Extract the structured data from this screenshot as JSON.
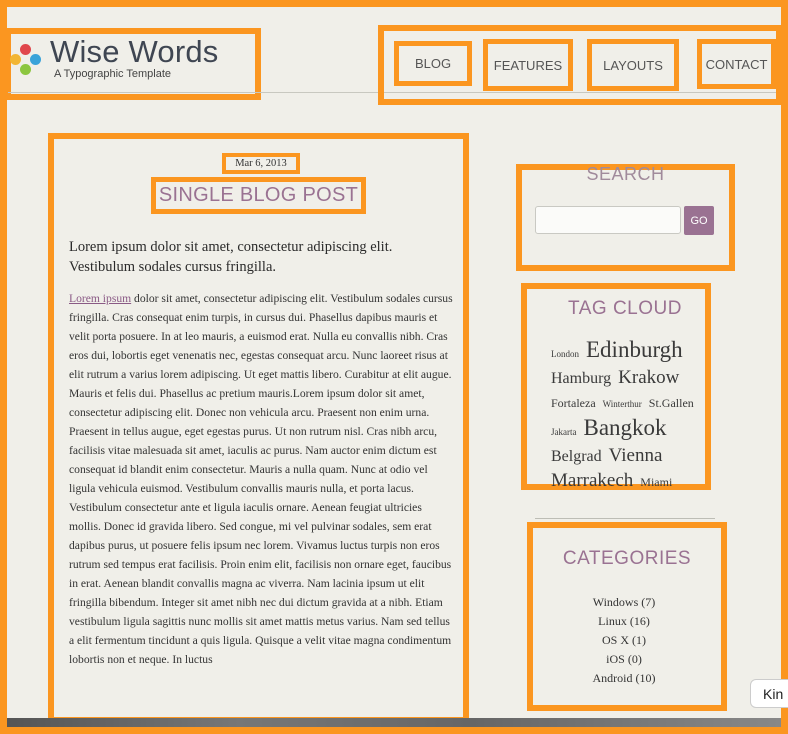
{
  "header": {
    "site_title": "Wise Words",
    "tagline": "A Typographic Template",
    "logo_colors": [
      "#e0474c",
      "#3aa3d9",
      "#f2b634",
      "#8cc63f"
    ]
  },
  "nav": {
    "items": [
      "BLOG",
      "FEATURES",
      "LAYOUTS",
      "CONTACT"
    ]
  },
  "post": {
    "date": "Mar 6, 2013",
    "title": "SINGLE BLOG POST",
    "lead": "Lorem ipsum dolor sit amet, consectetur adipiscing elit. Vestibulum sodales cursus fringilla.",
    "link_text": "Lorem ipsum",
    "body": " dolor sit amet, consectetur adipiscing elit. Vestibulum sodales cursus fringilla. Cras consequat enim turpis, in cursus dui. Phasellus dapibus mauris et velit porta posuere. In at leo mauris, a euismod erat. Nulla eu convallis nibh. Cras eros dui, lobortis eget venenatis nec, egestas consequat arcu. Nunc laoreet risus at elit rutrum a varius lorem adipiscing. Ut eget mattis libero. Curabitur at elit augue. Mauris et felis dui. Phasellus ac pretium mauris.Lorem ipsum dolor sit amet, consectetur adipiscing elit. Donec non vehicula arcu. Praesent non enim urna. Praesent in tellus augue, eget egestas purus. Ut non rutrum nisl. Cras nibh arcu, facilisis vitae malesuada sit amet, iaculis ac purus. Nam auctor enim dictum est consequat id blandit enim consectetur. Mauris a nulla quam. Nunc at odio vel ligula vehicula euismod. Vestibulum convallis mauris nulla, et porta lacus. Vestibulum consectetur ante et ligula iaculis ornare. Aenean feugiat ultricies mollis. Donec id gravida libero. Sed congue, mi vel pulvinar sodales, sem erat dapibus purus, ut posuere felis ipsum nec lorem. Vivamus luctus turpis non eros rutrum sed tempus erat facilisis. Proin enim elit, facilisis non ornare eget, faucibus in erat. Aenean blandit convallis magna ac viverra. Nam lacinia ipsum ut elit fringilla bibendum. Integer sit amet nibh nec dui dictum gravida at a nibh. Etiam vestibulum ligula sagittis nunc mollis sit amet mattis metus varius. Nam sed tellus a elit fermentum tincidunt a quis ligula. Quisque a velit vitae magna condimentum lobortis non et neque. In luctus"
  },
  "search": {
    "title": "SEARCH",
    "button": "GO",
    "placeholder": ""
  },
  "tag_cloud": {
    "title": "TAG CLOUD",
    "tags": [
      {
        "label": "London",
        "weight": 1
      },
      {
        "label": "Edinburgh",
        "weight": 5
      },
      {
        "label": "Hamburg",
        "weight": 3
      },
      {
        "label": "Krakow",
        "weight": 4
      },
      {
        "label": "Fortaleza",
        "weight": 2
      },
      {
        "label": "Winterthur",
        "weight": 1
      },
      {
        "label": "St.Gallen",
        "weight": 2
      },
      {
        "label": "Jakarta",
        "weight": 1
      },
      {
        "label": "Bangkok",
        "weight": 5
      },
      {
        "label": "Belgrad",
        "weight": 3
      },
      {
        "label": "Vienna",
        "weight": 4
      },
      {
        "label": "Marrakech",
        "weight": 4
      },
      {
        "label": "Miami",
        "weight": 2
      }
    ]
  },
  "categories": {
    "title": "CATEGORIES",
    "items": [
      {
        "label": "Windows (7)"
      },
      {
        "label": "Linux (16)"
      },
      {
        "label": "OS X (1)"
      },
      {
        "label": "iOS (0)"
      },
      {
        "label": "Android (10)"
      }
    ]
  },
  "chat_button": "Kin",
  "colors": {
    "highlight": "#fb9620",
    "accent": "#9a7292",
    "background": "#f0efe9"
  }
}
